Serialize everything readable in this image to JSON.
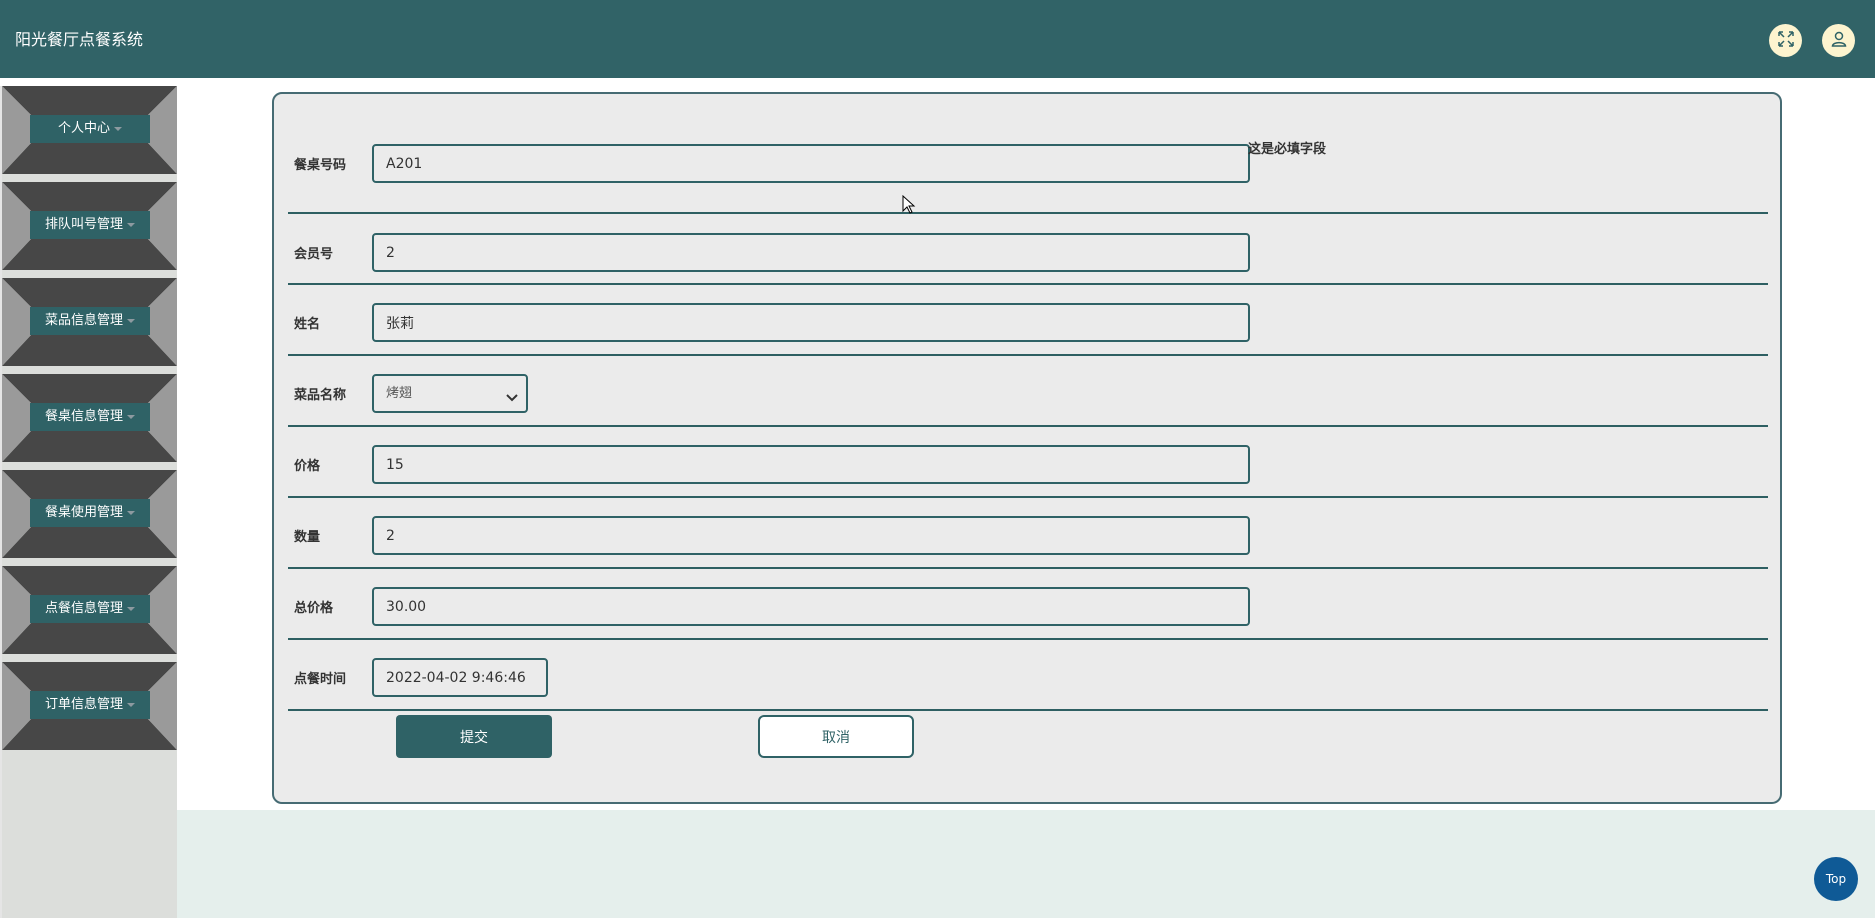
{
  "header": {
    "title": "阳光餐厅点餐系统",
    "fullscreen_icon": "fullscreen-icon",
    "user_icon": "user-icon",
    "icon_bg": "#fdf4cf",
    "bar_color": "#316367"
  },
  "sidebar": {
    "items": [
      {
        "label": "个人中心"
      },
      {
        "label": "排队叫号管理"
      },
      {
        "label": "菜品信息管理"
      },
      {
        "label": "餐桌信息管理"
      },
      {
        "label": "餐桌使用管理"
      },
      {
        "label": "点餐信息管理"
      },
      {
        "label": "订单信息管理"
      }
    ]
  },
  "form": {
    "fields": {
      "table_no": {
        "label": "餐桌号码",
        "value": "A201"
      },
      "member_no": {
        "label": "会员号",
        "value": "2"
      },
      "name": {
        "label": "姓名",
        "value": "张莉"
      },
      "dish": {
        "label": "菜品名称",
        "value": "烤翅"
      },
      "price": {
        "label": "价格",
        "value": "15"
      },
      "quantity": {
        "label": "数量",
        "value": "2"
      },
      "total": {
        "label": "总价格",
        "value": "30.00"
      },
      "order_time": {
        "label": "点餐时间",
        "value": "2022-04-02 9:46:46"
      }
    },
    "required_note": "这是必填字段",
    "submit_label": "提交",
    "cancel_label": "取消"
  },
  "back_to_top": "Top",
  "colors": {
    "accent": "#2f6266",
    "panel_bg": "#ebebeb",
    "top_button": "#0f5a96"
  }
}
